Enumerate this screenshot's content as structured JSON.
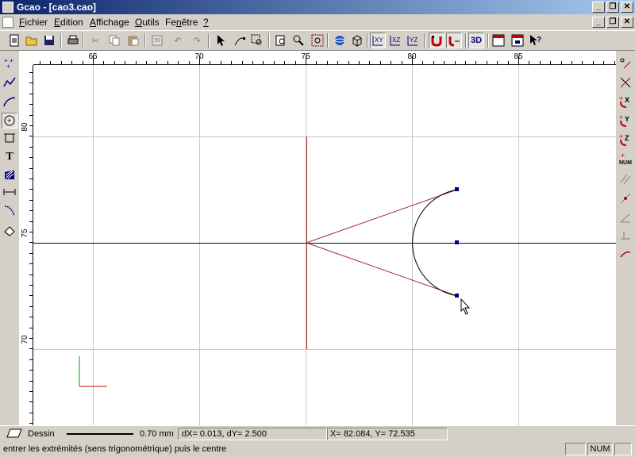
{
  "window": {
    "title": "Gcao - [cao3.cao]"
  },
  "menu": {
    "items": [
      {
        "label": "Fichier"
      },
      {
        "label": "Edition"
      },
      {
        "label": "Affichage"
      },
      {
        "label": "Outils"
      },
      {
        "label": "Fenêtre"
      },
      {
        "label": "?"
      }
    ]
  },
  "toolbar": {
    "buttons": [
      {
        "icon": "new-doc-icon"
      },
      {
        "icon": "open-folder-icon"
      },
      {
        "icon": "save-icon"
      },
      {
        "icon": "print-icon"
      },
      {
        "icon": "cut-icon"
      },
      {
        "icon": "copy-icon"
      },
      {
        "icon": "paste-icon"
      },
      {
        "icon": "properties-icon"
      },
      {
        "icon": "undo-icon"
      },
      {
        "icon": "redo-icon"
      },
      {
        "icon": "select-arrow-icon"
      },
      {
        "icon": "edit-node-icon"
      },
      {
        "icon": "zoom-window-icon"
      },
      {
        "icon": "zoom-icon"
      },
      {
        "icon": "zoom-pan-icon"
      },
      {
        "icon": "zoom-all-icon"
      },
      {
        "icon": "sphere-icon"
      },
      {
        "icon": "cube-icon"
      },
      {
        "icon": "plane-xy-icon",
        "label": "XY"
      },
      {
        "icon": "plane-xz-icon",
        "label": "XZ"
      },
      {
        "icon": "plane-yz-icon",
        "label": "YZ"
      },
      {
        "icon": "magnet-snap-icon"
      },
      {
        "icon": "snap-point-icon"
      },
      {
        "icon": "3d-view-icon",
        "label": "3D"
      },
      {
        "icon": "export-2d-icon"
      },
      {
        "icon": "export-3d-icon"
      },
      {
        "icon": "help-pointer-icon"
      }
    ]
  },
  "rulers": {
    "horizontal": [
      "65",
      "70",
      "75",
      "80",
      "85"
    ],
    "vertical": [
      "80",
      "75",
      "70"
    ]
  },
  "right_tools": {
    "labels": [
      "X",
      "Y",
      "Z",
      "NUM"
    ]
  },
  "status": {
    "mode": "Dessin",
    "line_width": "0.70 mm",
    "delta": "dX=    0.013, dY=    2.500",
    "coords": "X=    82.084, Y=    72.535",
    "hint": "entrer les extrémités (sens trigonométrique) puis le centre",
    "num": "NUM"
  },
  "colors": {
    "title_start": "#0a246a",
    "title_end": "#a6caf0",
    "construction_line": "#a52a2a",
    "axis_line": "#000080"
  }
}
